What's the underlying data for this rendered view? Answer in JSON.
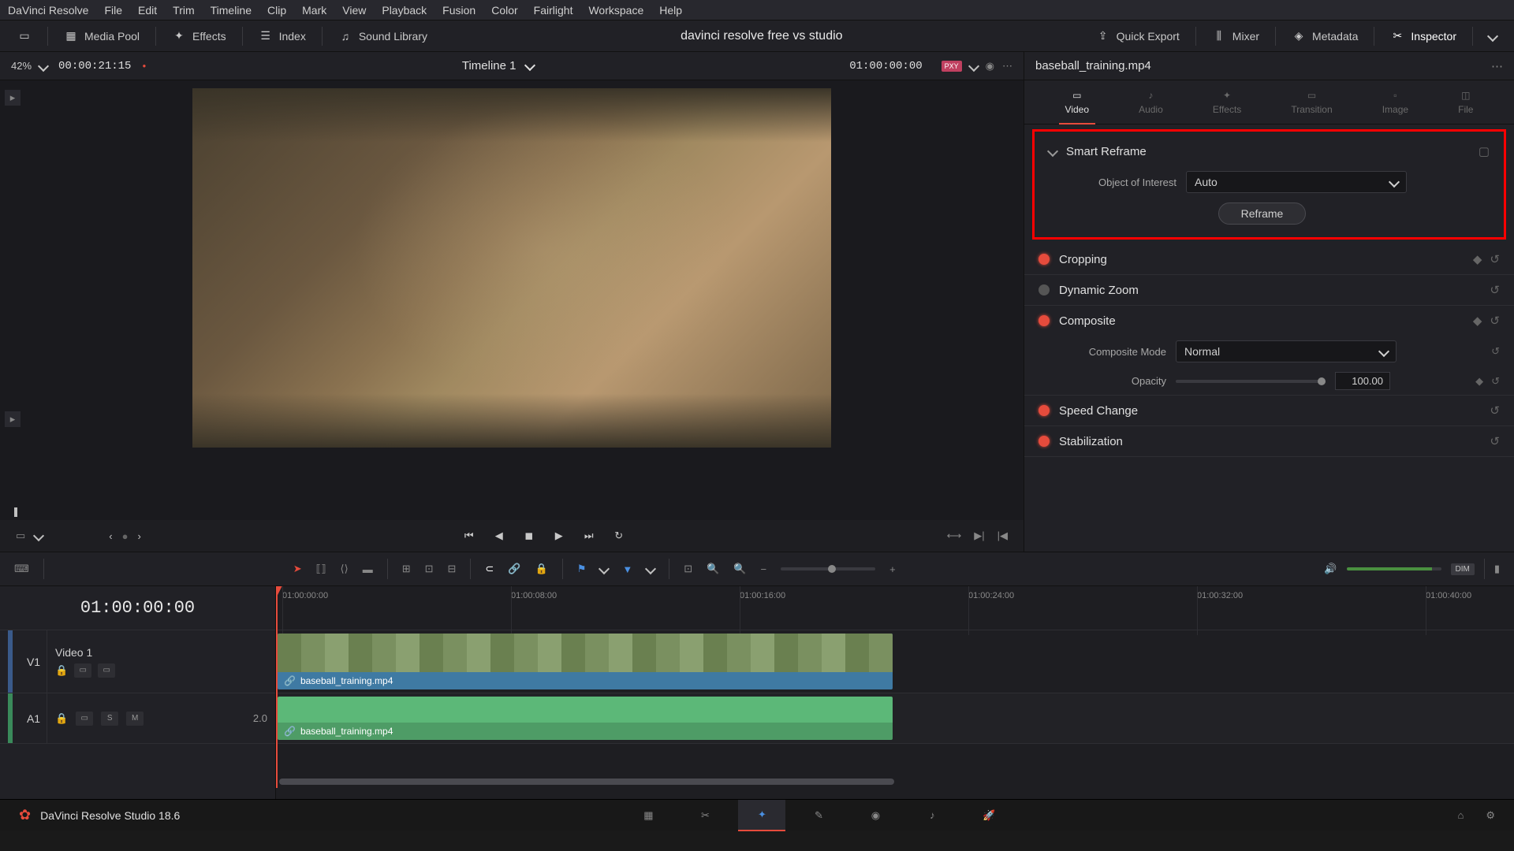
{
  "menu": {
    "app": "DaVinci Resolve",
    "items": [
      "File",
      "Edit",
      "Trim",
      "Timeline",
      "Clip",
      "Mark",
      "View",
      "Playback",
      "Fusion",
      "Color",
      "Fairlight",
      "Workspace",
      "Help"
    ]
  },
  "toolbar": {
    "mediaPool": "Media Pool",
    "effects": "Effects",
    "index": "Index",
    "soundLib": "Sound Library",
    "title": "davinci resolve free vs studio",
    "quickExport": "Quick Export",
    "mixer": "Mixer",
    "metadata": "Metadata",
    "inspector": "Inspector"
  },
  "viewer": {
    "zoom": "42%",
    "timecode": "00:00:21:15",
    "timelineName": "Timeline 1",
    "rightTimecode": "01:00:00:00"
  },
  "inspector": {
    "clipName": "baseball_training.mp4",
    "tabs": [
      "Video",
      "Audio",
      "Effects",
      "Transition",
      "Image",
      "File"
    ],
    "smartReframe": {
      "title": "Smart Reframe",
      "objectLabel": "Object of Interest",
      "objectValue": "Auto",
      "reframeBtn": "Reframe"
    },
    "groups": {
      "cropping": "Cropping",
      "dynamicZoom": "Dynamic Zoom",
      "composite": "Composite",
      "compositeModeLabel": "Composite Mode",
      "compositeModeValue": "Normal",
      "opacityLabel": "Opacity",
      "opacityValue": "100.00",
      "speedChange": "Speed Change",
      "stabilization": "Stabilization"
    }
  },
  "timeline": {
    "timecode": "01:00:00:00",
    "ruler": [
      "01:00:00:00",
      "01:00:08:00",
      "01:00:16:00",
      "01:00:24:00",
      "01:00:32:00",
      "01:00:40:00"
    ],
    "tracks": {
      "v1": {
        "label": "V1",
        "name": "Video 1"
      },
      "a1": {
        "label": "A1",
        "s": "S",
        "m": "M",
        "vol": "2.0"
      }
    },
    "clipName": "baseball_training.mp4"
  },
  "footer": {
    "appVersion": "DaVinci Resolve Studio 18.6"
  }
}
